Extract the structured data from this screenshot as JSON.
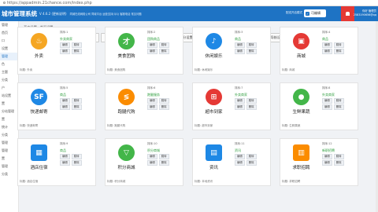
{
  "address": {
    "url": "https://appadmin.21chance.com/index.php"
  },
  "header": {
    "brand": "城市管理系统",
    "version": "V 4.6.2 (更新说明)",
    "info": "同城在线网络公司 同城平台 运营支持(QQ) 客服电话 常见问题",
    "mode": "配送开启模式",
    "edit_label": "可编辑",
    "user_line1": "你好 管理员",
    "user_line2": "2583190656@qq"
  },
  "sidebar": {
    "items": [
      "管理",
      "首页",
      "口",
      "设置",
      "管理",
      "色",
      "主题",
      "分类",
      "户",
      "站设置",
      "置",
      "分站管理",
      "置",
      "统计",
      "分类",
      "管理",
      "管理",
      "置",
      "管理",
      "分类"
    ]
  },
  "breadcrumb": "基本设置 · 首页设置",
  "tabs": [
    {
      "label": "首页菜单",
      "active": true
    },
    {
      "label": "同城服务"
    },
    {
      "label": "分类信息"
    },
    {
      "label": "启动图片"
    },
    {
      "label": "频道推荐"
    },
    {
      "label": "商家推荐"
    },
    {
      "label": "优惠积分设置"
    },
    {
      "label": "二级页面模块设置"
    },
    {
      "label": "搜索关键字设置"
    },
    {
      "label": "导航设置"
    }
  ],
  "cards": [
    {
      "sort": "排序:1",
      "name": "外卖",
      "tag": "外卖商家",
      "foot": "标题: 外卖",
      "color": "#f5a623",
      "icon": "♨"
    },
    {
      "sort": "排序:2",
      "name": "美食团购",
      "tag": "团购商品",
      "foot": "标题: 美食团购",
      "color": "#43b649",
      "icon": "才"
    },
    {
      "sort": "排序:3",
      "name": "休闲娱乐",
      "tag": "商品",
      "foot": "标题: 休闲娱乐",
      "color": "#1e88e5",
      "icon": "♪"
    },
    {
      "sort": "排序:4",
      "name": "商城",
      "tag": "商品",
      "foot": "标题: 商城",
      "color": "#e53935",
      "icon": "▣"
    },
    {
      "sort": "排序:5",
      "name": "快递邮寄",
      "tag": "商品",
      "foot": "标题: 快递邮寄",
      "color": "#1e88e5",
      "icon": "SF"
    },
    {
      "sort": "排序:6",
      "name": "跑腿代购",
      "tag": "跑腿服务",
      "foot": "标题: 跑腿代购",
      "color": "#fb8c00",
      "icon": "≶"
    },
    {
      "sort": "排序:7",
      "name": "超市到家",
      "tag": "外卖商家",
      "foot": "标题: 超市到家",
      "color": "#e53935",
      "icon": "⊞"
    },
    {
      "sort": "排序:8",
      "name": "生鲜果蔬",
      "tag": "外卖商家",
      "foot": "标题: 生鲜果蔬",
      "color": "#43b649",
      "icon": "●"
    },
    {
      "sort": "排序:9",
      "name": "酒店住宿",
      "tag": "商品",
      "foot": "标题: 酒店住宿",
      "color": "#1e88e5",
      "icon": "▦",
      "sq": true
    },
    {
      "sort": "排序:10",
      "name": "积分商城",
      "tag": "积分商城",
      "foot": "标题: 积分商城",
      "color": "#43b649",
      "icon": "▽"
    },
    {
      "sort": "排序:11",
      "name": "资讯",
      "tag": "资讯",
      "foot": "标题: 本地资讯",
      "color": "#1e88e5",
      "icon": "▤",
      "sq": true
    },
    {
      "sort": "排序:12",
      "name": "求职招聘",
      "tag": "新职招聘",
      "foot": "标题: 求职招聘",
      "color": "#fb8c00",
      "icon": "▥",
      "sq": true
    }
  ],
  "btn_edit": "编辑",
  "btn_jump": "跳转",
  "btn_delete": "删除"
}
